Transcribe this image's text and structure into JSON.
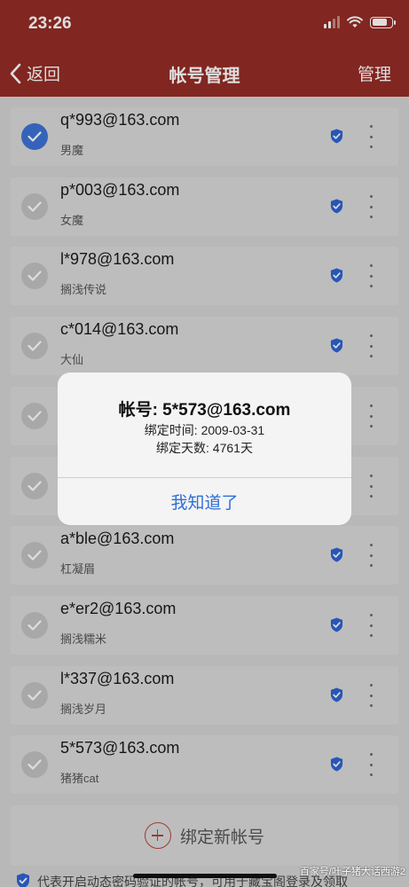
{
  "status_bar": {
    "time": "23:26"
  },
  "navbar": {
    "back_label": "返回",
    "title": "帐号管理",
    "manage_label": "管理"
  },
  "accounts": [
    {
      "email": "q*993@163.com",
      "nickname": "男魔",
      "selected": true
    },
    {
      "email": "p*003@163.com",
      "nickname": "女魔",
      "selected": false
    },
    {
      "email": "l*978@163.com",
      "nickname": "搁浅传说",
      "selected": false
    },
    {
      "email": "c*014@163.com",
      "nickname": "大仙",
      "selected": false
    },
    {
      "email": "",
      "nickname": "",
      "selected": false
    },
    {
      "email": "",
      "nickname": "",
      "selected": false
    },
    {
      "email": "a*ble@163.com",
      "nickname": "杠凝眉",
      "selected": false
    },
    {
      "email": "e*er2@163.com",
      "nickname": "搁浅糯米",
      "selected": false
    },
    {
      "email": "l*337@163.com",
      "nickname": "搁浅岁月",
      "selected": false
    },
    {
      "email": "5*573@163.com",
      "nickname": "猪猪cat",
      "selected": false
    }
  ],
  "add_account": {
    "label": "绑定新帐号"
  },
  "footer_note": {
    "text": "代表开启动态密码验证的帐号，可用于藏宝阁登录及领取"
  },
  "dialog": {
    "title": "帐号: 5*573@163.com",
    "bind_time": "绑定时间: 2009-03-31",
    "bind_days": "绑定天数: 4761天",
    "button_label": "我知道了"
  },
  "watermark": "百家号/叶子猪大话西游2",
  "colors": {
    "header_bg": "#952c25",
    "check_selected": "#3d72d6",
    "shield": "#2f63d4",
    "dialog_button": "#2f6fd6",
    "add_icon": "#b6433a"
  }
}
